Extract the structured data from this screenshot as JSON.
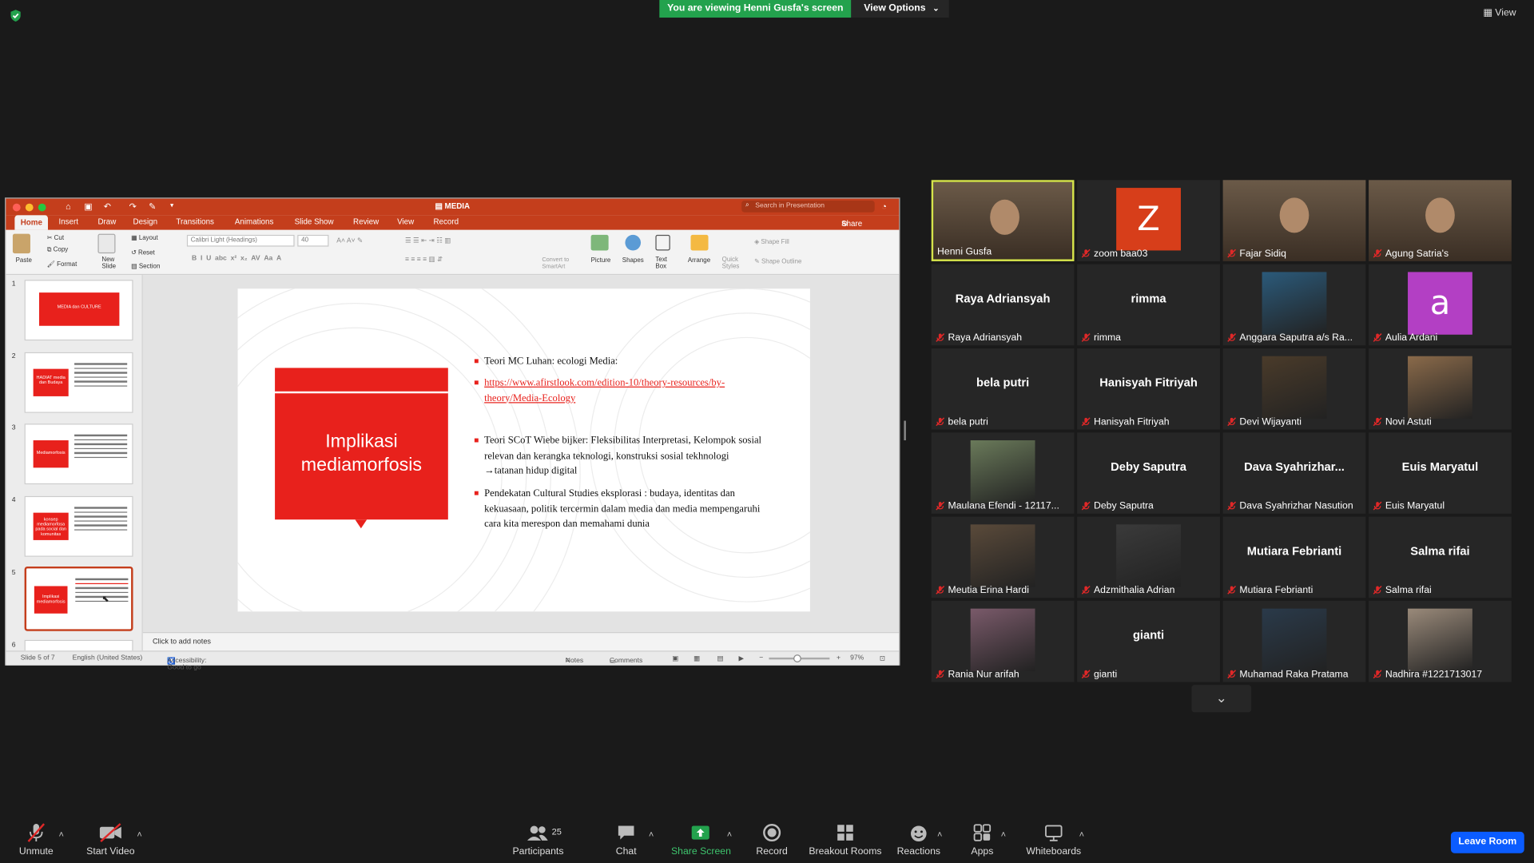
{
  "zoom_top": {
    "banner": "You are viewing Henni Gusfa's screen",
    "view_options": "View Options",
    "view": "View"
  },
  "ppt": {
    "doc_title": "MEDIA",
    "search_placeholder": "Search in Presentation",
    "share": "Share",
    "tabs": [
      "Home",
      "Insert",
      "Draw",
      "Design",
      "Transitions",
      "Animations",
      "Slide Show",
      "Review",
      "View",
      "Record"
    ],
    "ribbon": {
      "paste": "Paste",
      "cut": "Cut",
      "copy": "Copy",
      "format": "Format",
      "new_slide": "New\nSlide",
      "layout": "Layout",
      "reset": "Reset",
      "section": "Section",
      "font": "Calibri Light (Headings)",
      "size": "40",
      "convert": "Convert to SmartArt",
      "picture": "Picture",
      "shapes": "Shapes",
      "text_box": "Text Box",
      "arrange": "Arrange",
      "quick_styles": "Quick Styles",
      "shape_fill": "Shape Fill",
      "shape_outline": "Shape Outline"
    },
    "thumbs": [
      {
        "n": "1",
        "t": "MEDIA dan CULTURE"
      },
      {
        "n": "2",
        "t": "HADIAT media dan Budaya"
      },
      {
        "n": "3",
        "t": "Mediamorfosis"
      },
      {
        "n": "4",
        "t": "konsep mediamorfosa pada social dan komunitas"
      },
      {
        "n": "5",
        "t": "Implikasi mediamorfosis"
      },
      {
        "n": "6",
        "t": ""
      }
    ],
    "slide": {
      "title": "Implikasi mediamorfosis",
      "b1": "Teori MC Luhan: ecologi Media:",
      "b2": "https://www.afirstlook.com/edition-10/theory-resources/by-theory/Media-Ecology",
      "b3": "Teori SCoT Wiebe bijker: Fleksibilitas Interpretasi, Kelompok sosial relevan dan kerangka teknologi, konstruksi sosial tekhnologi →tatanan hidup digital",
      "b4": "Pendekatan Cultural Studies eksplorasi : budaya, identitas dan kekuasaan, politik tercermin dalam media dan media mempengaruhi cara kita merespon dan memahami dunia"
    },
    "notes": "Click to add notes",
    "status": {
      "slide": "Slide 5 of 7",
      "lang": "English (United States)",
      "access": "Accessibility: Good to go",
      "notes": "Notes",
      "comments": "Comments",
      "zoom": "97%"
    }
  },
  "participants": [
    {
      "name": "Henni Gusfa",
      "type": "video",
      "active": true,
      "muted": false
    },
    {
      "name": "zoom baa03",
      "type": "avatar",
      "letter": "Z",
      "color": "#d73e1a",
      "muted": true
    },
    {
      "name": "Fajar Sidiq",
      "type": "video",
      "muted": true
    },
    {
      "name": "Agung Satria's",
      "type": "video",
      "muted": true
    },
    {
      "name": "Raya Adriansyah",
      "type": "name",
      "center": "Raya Adriansyah",
      "muted": true
    },
    {
      "name": "rimma",
      "type": "name",
      "center": "rimma",
      "muted": true
    },
    {
      "name": "Anggara Saputra a/s Ra...",
      "type": "pic",
      "muted": true
    },
    {
      "name": "Aulia Ardani",
      "type": "avatar",
      "letter": "a",
      "color": "#b33fc4",
      "muted": true
    },
    {
      "name": "bela putri",
      "type": "name",
      "center": "bela putri",
      "muted": true
    },
    {
      "name": "Hanisyah Fitriyah",
      "type": "name",
      "center": "Hanisyah Fitriyah",
      "muted": true
    },
    {
      "name": "Devi Wijayanti",
      "type": "pic",
      "muted": true
    },
    {
      "name": "Novi Astuti",
      "type": "pic",
      "muted": true
    },
    {
      "name": "Maulana Efendi - 12117...",
      "type": "pic",
      "muted": true
    },
    {
      "name": "Deby Saputra",
      "type": "name",
      "center": "Deby Saputra",
      "muted": true
    },
    {
      "name": "Dava Syahrizhar Nasution",
      "type": "name",
      "center": "Dava  Syahrizhar...",
      "muted": true
    },
    {
      "name": "Euis Maryatul",
      "type": "name",
      "center": "Euis Maryatul",
      "muted": true
    },
    {
      "name": "Meutia Erina Hardi",
      "type": "pic",
      "muted": true
    },
    {
      "name": "Adzmithalia Adrian",
      "type": "pic",
      "muted": true
    },
    {
      "name": "Mutiara Febrianti",
      "type": "name",
      "center": "Mutiara Febrianti",
      "muted": true
    },
    {
      "name": "Salma rifai",
      "type": "name",
      "center": "Salma rifai",
      "muted": true
    },
    {
      "name": "Rania Nur arifah",
      "type": "pic",
      "muted": true
    },
    {
      "name": "gianti",
      "type": "name",
      "center": "gianti",
      "muted": true
    },
    {
      "name": "Muhamad Raka Pratama",
      "type": "pic",
      "muted": true
    },
    {
      "name": "Nadhira #1221713017",
      "type": "pic",
      "muted": true
    }
  ],
  "toolbar": {
    "unmute": "Unmute",
    "start_video": "Start Video",
    "participants": "Participants",
    "participant_count": "25",
    "chat": "Chat",
    "share_screen": "Share Screen",
    "record": "Record",
    "breakout": "Breakout Rooms",
    "reactions": "Reactions",
    "apps": "Apps",
    "whiteboards": "Whiteboards",
    "leave": "Leave Room"
  }
}
